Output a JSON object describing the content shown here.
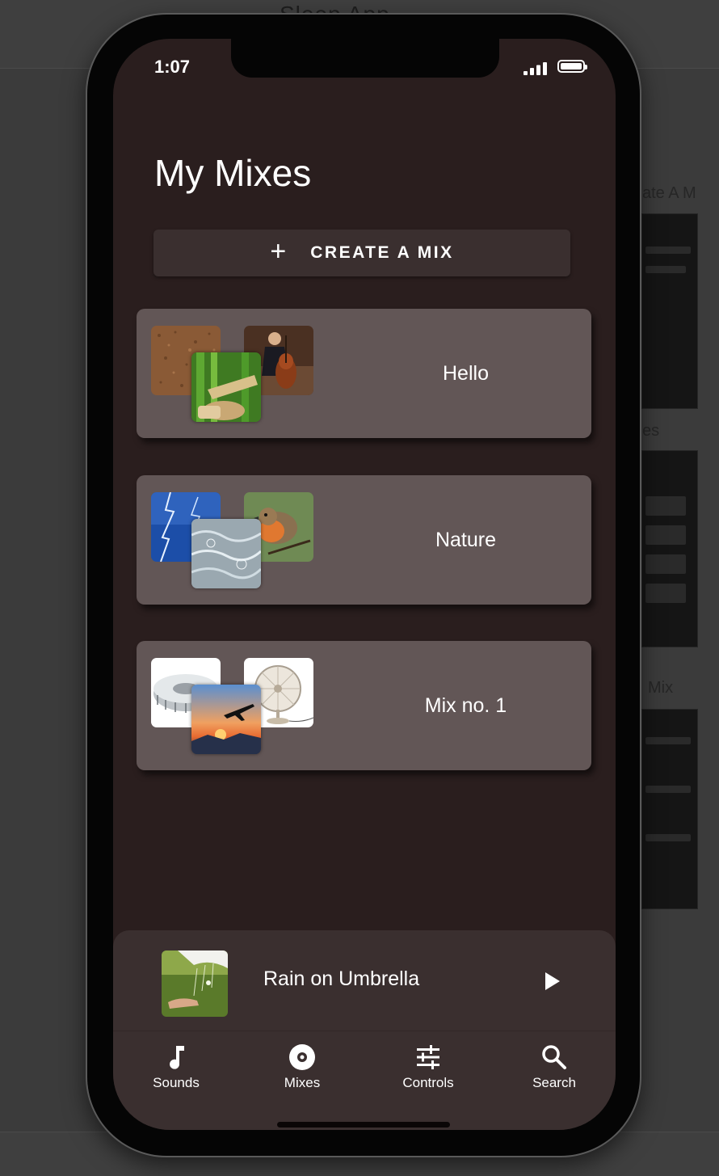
{
  "canvas": {
    "title": "Sleep App",
    "labels": [
      "ate A M",
      "es",
      "Mix"
    ]
  },
  "status_bar": {
    "time": "1:07"
  },
  "header": {
    "title": "My Mixes"
  },
  "create_button": {
    "icon": "plus-icon",
    "label": "CREATE A MIX"
  },
  "mixes": [
    {
      "name": "Hello",
      "thumbnails": [
        "cork-texture",
        "cellist",
        "bamboo-fountain"
      ]
    },
    {
      "name": "Nature",
      "thumbnails": [
        "lightning-storm",
        "robin-bird",
        "rain-water"
      ]
    },
    {
      "name": "Mix no. 1",
      "thumbnails": [
        "air-filter",
        "desk-fan",
        "airplane-sunset"
      ]
    }
  ],
  "now_playing": {
    "title": "Rain on Umbrella",
    "thumbnail": "rain-umbrella",
    "action_icon": "play-icon"
  },
  "tab_bar": [
    {
      "label": "Sounds",
      "icon": "music-note-icon"
    },
    {
      "label": "Mixes",
      "icon": "disc-icon"
    },
    {
      "label": "Controls",
      "icon": "sliders-icon"
    },
    {
      "label": "Search",
      "icon": "search-icon"
    }
  ],
  "colors": {
    "screen_bg": "#2a1e1e",
    "card_bg": "#625656",
    "button_bg": "#3a2f2f",
    "text": "#ffffff"
  }
}
